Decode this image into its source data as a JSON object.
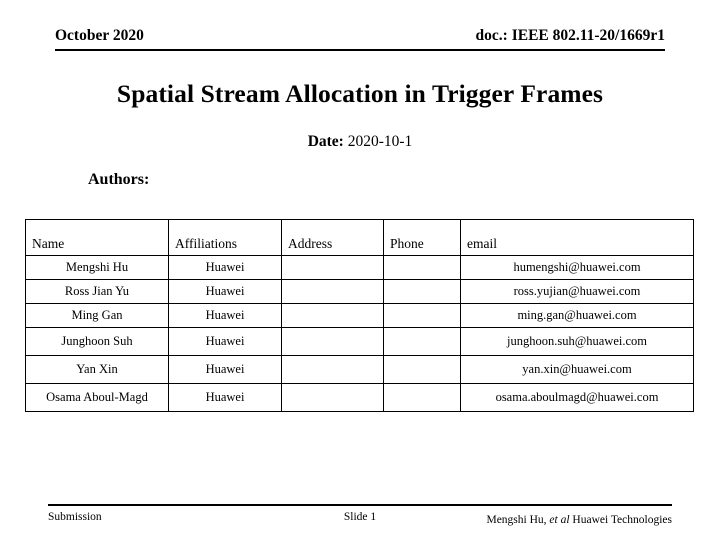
{
  "header": {
    "date": "October 2020",
    "doc_id": "doc.: IEEE 802.11-20/1669r1"
  },
  "title": "Spatial Stream Allocation in Trigger Frames",
  "date_line": {
    "label": "Date:",
    "value": "2020-10-1"
  },
  "authors_label": "Authors:",
  "authors_table": {
    "columns": [
      "Name",
      "Affiliations",
      "Address",
      "Phone",
      "email"
    ],
    "rows": [
      {
        "name": "Mengshi Hu",
        "affiliation": "Huawei",
        "address": "",
        "phone": "",
        "email": "humengshi@huawei.com"
      },
      {
        "name": "Ross Jian Yu",
        "affiliation": "Huawei",
        "address": "",
        "phone": "",
        "email": "ross.yujian@huawei.com"
      },
      {
        "name": "Ming Gan",
        "affiliation": "Huawei",
        "address": "",
        "phone": "",
        "email": "ming.gan@huawei.com"
      },
      {
        "name": "Junghoon Suh",
        "affiliation": "Huawei",
        "address": "",
        "phone": "",
        "email": "junghoon.suh@huawei.com"
      },
      {
        "name": "Yan Xin",
        "affiliation": "Huawei",
        "address": "",
        "phone": "",
        "email": "yan.xin@huawei.com"
      },
      {
        "name": "Osama Aboul-Magd",
        "affiliation": "Huawei",
        "address": "",
        "phone": "",
        "email": "osama.aboulmagd@huawei.com"
      }
    ]
  },
  "footer": {
    "left": "Submission",
    "center": "Slide 1",
    "right_prefix": "Mengshi Hu,",
    "right_italic": "et al",
    "right_suffix": "Huawei Technologies"
  },
  "colors": {
    "text": "#000000",
    "background": "#ffffff",
    "rule": "#000000"
  }
}
